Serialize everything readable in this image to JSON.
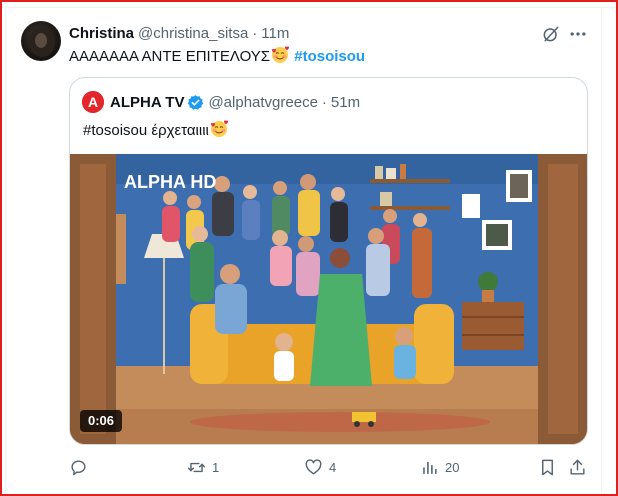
{
  "tweet": {
    "author_name": "Christina",
    "author_handle": "@christina_sitsa",
    "time": "11m",
    "separator": "·",
    "text": "ΑΑΑΑΑΑΑ ΑΝΤΕ ΕΠΙΤΕΛΟΥΣ",
    "hashtag": "#tosoisou",
    "emoji": "smiling-face-with-hearts"
  },
  "quote": {
    "author_name": "ALPHA TV",
    "author_handle": "@alphatvgreece",
    "time": "51m",
    "separator": "·",
    "text_hashtag": "#tosoisou",
    "text": " έρχεταιιιι",
    "emoji": "smiling-face-with-hearts",
    "video_duration": "0:06",
    "logo_text": "A",
    "channel_logo": "ALPHA HD"
  },
  "actions": {
    "reply_count": "",
    "retweet_count": "1",
    "like_count": "4",
    "views_count": "20"
  },
  "icons": [
    "grok-icon",
    "more-icon",
    "verified-badge-icon",
    "reply-icon",
    "retweet-icon",
    "like-icon",
    "views-icon",
    "bookmark-icon",
    "share-icon"
  ],
  "colors": {
    "accent": "#1d9bf0",
    "border_red": "#e0201f",
    "muted_text": "#536471",
    "brand_red": "#e2262b"
  }
}
